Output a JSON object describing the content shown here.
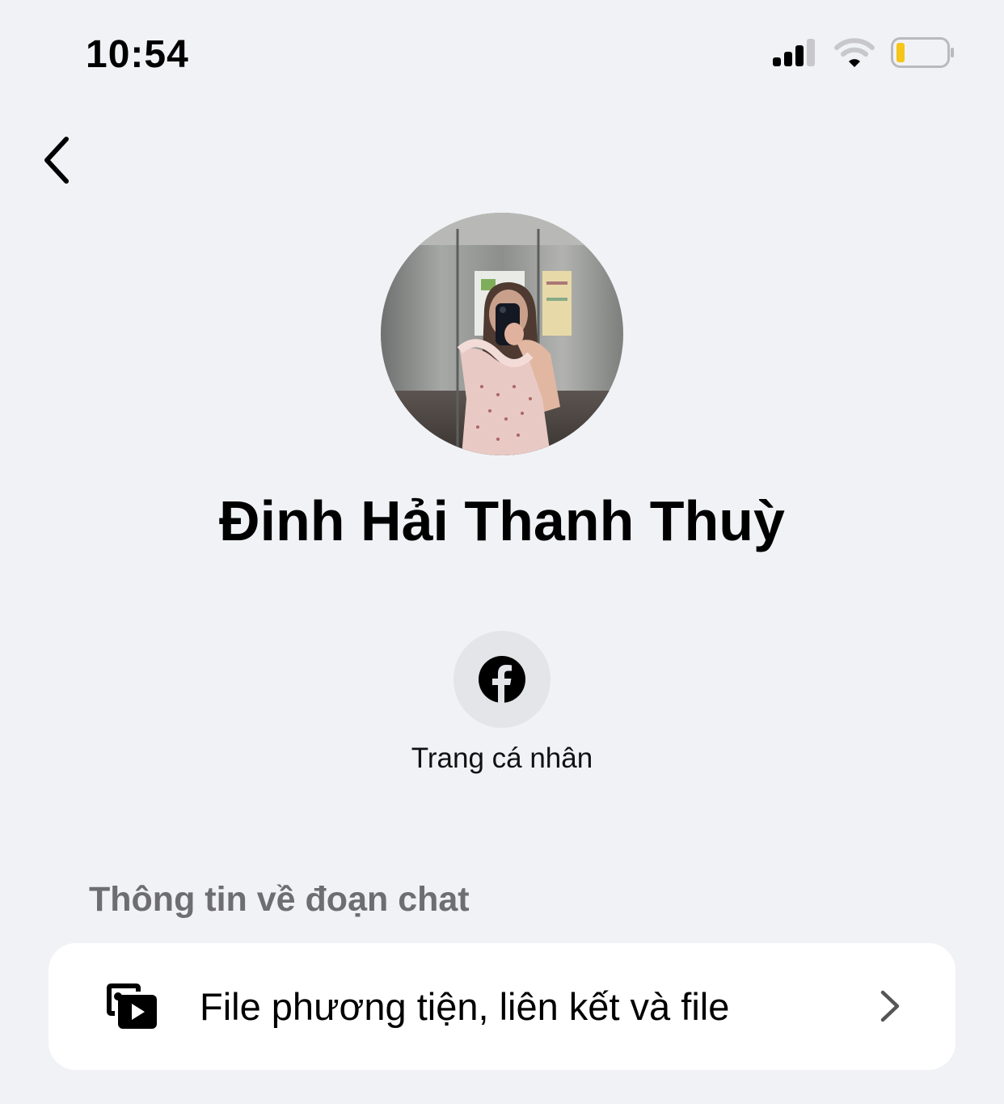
{
  "status_bar": {
    "time": "10:54",
    "icons": [
      "cellular-signal-icon",
      "wifi-icon",
      "battery-icon"
    ],
    "battery_color": "#f5c518"
  },
  "nav": {
    "back_icon": "chevron-left-icon"
  },
  "profile": {
    "name": "Đinh Hải Thanh Thuỳ",
    "avatar": "profile-photo"
  },
  "actions": [
    {
      "icon": "facebook-icon",
      "label": "Trang cá nhân"
    }
  ],
  "chat_info": {
    "section_title": "Thông tin về đoạn chat",
    "items": [
      {
        "icon": "media-files-icon",
        "label": "File phương tiện, liên kết và file",
        "chevron": "chevron-right-icon"
      }
    ]
  }
}
